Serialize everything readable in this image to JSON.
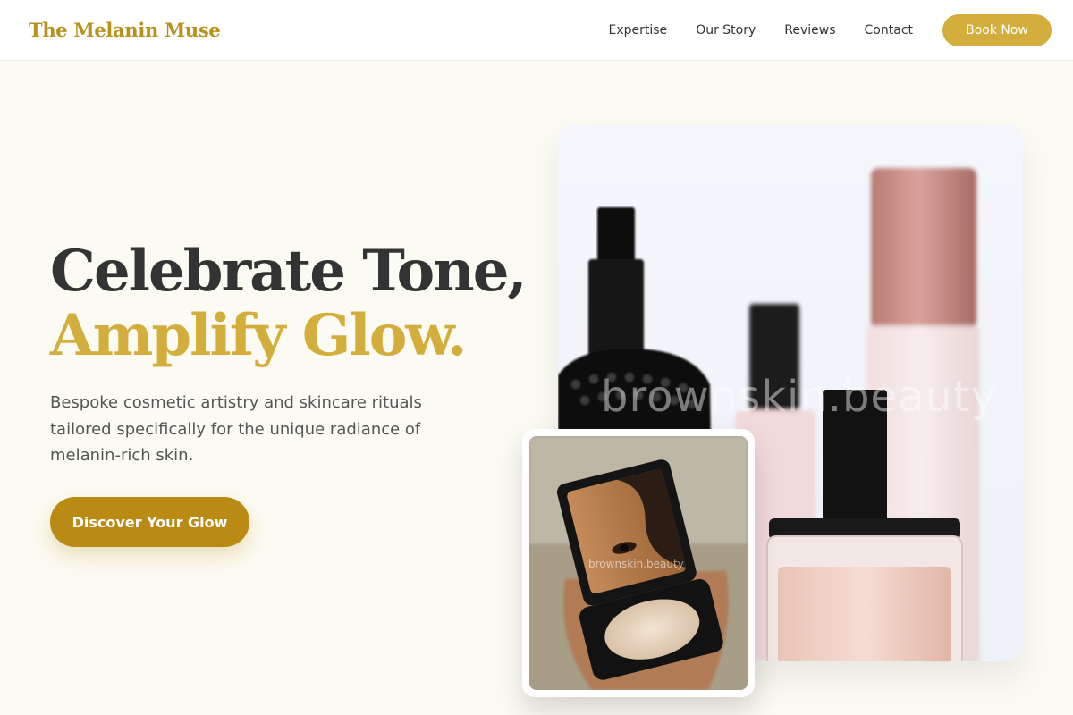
{
  "brand": {
    "name": "The Melanin Muse"
  },
  "nav": {
    "links": [
      "Expertise",
      "Our Story",
      "Reviews",
      "Contact"
    ],
    "cta": "Book Now"
  },
  "hero": {
    "title_line1": "Celebrate Tone,",
    "title_line2": "Amplify Glow.",
    "description": "Bespoke cosmetic artistry and skincare rituals tailored specifically for the unique radiance of melanin-rich skin.",
    "cta": "Discover Your Glow"
  },
  "images": {
    "main_watermark": "brownskin.beauty",
    "small_watermark": "brownskin.beauty"
  },
  "colors": {
    "accent": "#d4ae3d",
    "accent_dark": "#b98a14",
    "background": "#fcfbf3",
    "text": "#333333"
  }
}
